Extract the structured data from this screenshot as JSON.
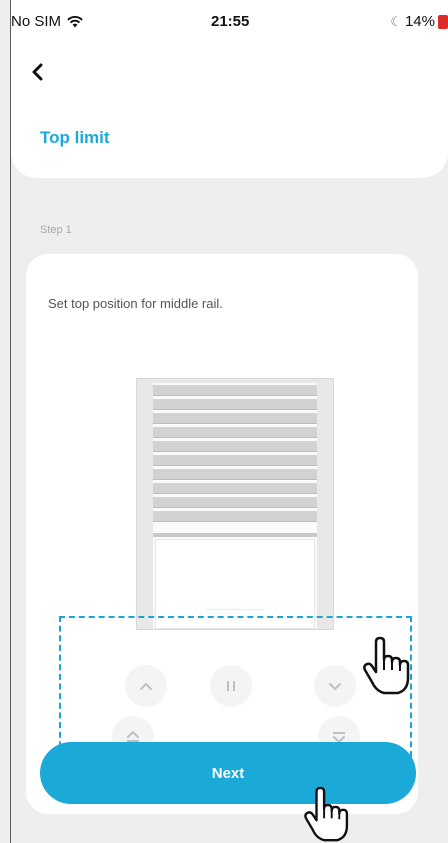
{
  "status_bar": {
    "carrier": "No SIM",
    "time": "21:55",
    "battery": "14%"
  },
  "header": {
    "title": "Top limit"
  },
  "step": {
    "label": "Step 1"
  },
  "card": {
    "instruction": "Set top position for middle rail."
  },
  "controls": {
    "up": "^",
    "pause": "II",
    "down": "v"
  },
  "footer": {
    "next_label": "Next"
  },
  "colors": {
    "accent": "#1ba9d8",
    "battery_low": "#e02b2b"
  }
}
